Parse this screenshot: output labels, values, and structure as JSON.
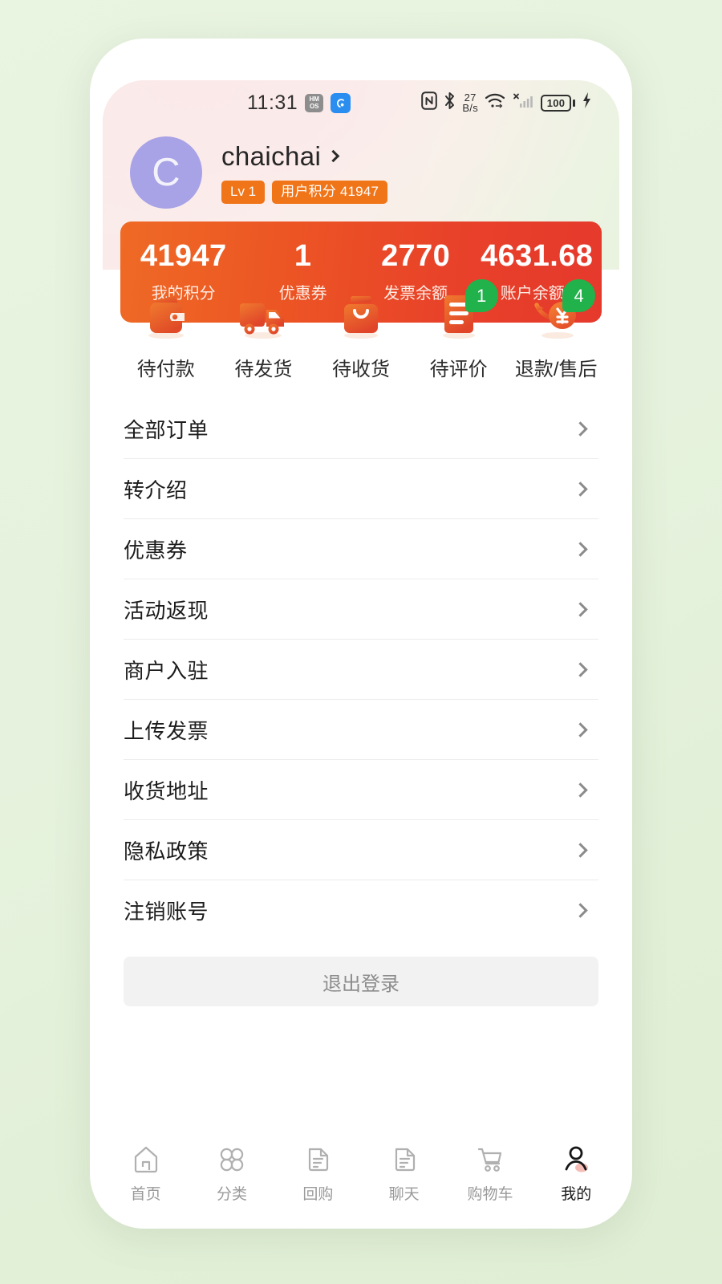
{
  "status_bar": {
    "time": "11:31",
    "hmos_line1": "HM",
    "hmos_line2": "OS",
    "app_icon": "weather-app-icon",
    "nfc_icon": "nfc-icon",
    "bluetooth_icon": "bluetooth-icon",
    "net_speed_value": "27",
    "net_speed_unit": "B/s",
    "wifi_icon": "wifi-icon",
    "signal_icon": "cellular-signal-icon",
    "battery_level": "100"
  },
  "profile": {
    "avatar_letter": "C",
    "avatar_color": "#a8a2e6",
    "user_name": "chaichai",
    "level_tag": "Lv 1",
    "points_tag": "用户积分 41947",
    "tag_color": "#f07418"
  },
  "stats_card": {
    "accent_from": "#ef6a25",
    "accent_to": "#e5392c",
    "items": [
      {
        "value": "41947",
        "label": "我的积分",
        "has_chevron": false
      },
      {
        "value": "1",
        "label": "优惠券",
        "has_chevron": false
      },
      {
        "value": "2770",
        "label": "发票余额",
        "has_chevron": false
      },
      {
        "value": "4631.68",
        "label": "账户余额",
        "has_chevron": true
      }
    ]
  },
  "order_status": {
    "items": [
      {
        "label": "待付款",
        "icon": "wallet-icon",
        "badge": null
      },
      {
        "label": "待发货",
        "icon": "truck-icon",
        "badge": null
      },
      {
        "label": "待收货",
        "icon": "shopping-bag-icon",
        "badge": null
      },
      {
        "label": "待评价",
        "icon": "review-document-icon",
        "badge": "1"
      },
      {
        "label": "退款/售后",
        "icon": "refund-yen-icon",
        "badge": "4"
      }
    ],
    "badge_color": "#21b24b"
  },
  "menu": {
    "items": [
      {
        "label": "全部订单"
      },
      {
        "label": "转介绍"
      },
      {
        "label": "优惠券"
      },
      {
        "label": "活动返现"
      },
      {
        "label": "商户入驻"
      },
      {
        "label": "上传发票"
      },
      {
        "label": "收货地址"
      },
      {
        "label": "隐私政策"
      },
      {
        "label": "注销账号"
      }
    ]
  },
  "logout": {
    "label": "退出登录"
  },
  "bottom_nav": {
    "items": [
      {
        "label": "首页",
        "icon": "home-icon",
        "active": false
      },
      {
        "label": "分类",
        "icon": "category-icon",
        "active": false
      },
      {
        "label": "回购",
        "icon": "repurchase-document-icon",
        "active": false
      },
      {
        "label": "聊天",
        "icon": "chat-document-icon",
        "active": false
      },
      {
        "label": "购物车",
        "icon": "shopping-cart-icon",
        "active": false
      },
      {
        "label": "我的",
        "icon": "profile-person-icon",
        "active": true
      }
    ]
  }
}
